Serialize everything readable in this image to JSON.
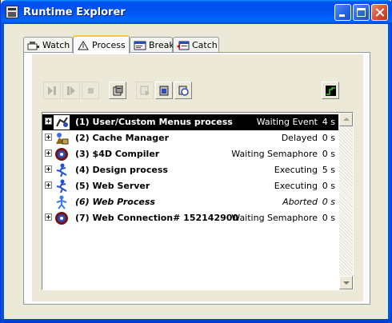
{
  "window": {
    "title": "Runtime Explorer"
  },
  "tabs": [
    {
      "label": "Watch",
      "icon": "watch-icon",
      "active": false
    },
    {
      "label": "Process",
      "icon": "process-icon",
      "active": true
    },
    {
      "label": "Break",
      "icon": "break-icon",
      "active": false
    },
    {
      "label": "Catch",
      "icon": "catch-icon",
      "active": false
    }
  ],
  "toolbar": {
    "buttons": [
      {
        "name": "abort-process-button",
        "icon": "abort-icon",
        "enabled": false
      },
      {
        "name": "pause-process-button",
        "icon": "pause-icon",
        "enabled": false
      },
      {
        "name": "stop-process-button",
        "icon": "stop-icon",
        "enabled": false
      },
      {
        "name": "process-info-button",
        "icon": "info-icon",
        "enabled": true
      },
      {
        "name": "debug-button",
        "icon": "debug-icon",
        "enabled": false
      },
      {
        "name": "trace-button",
        "icon": "trace-icon",
        "enabled": true
      },
      {
        "name": "show-window-button",
        "icon": "window-icon",
        "enabled": true
      },
      {
        "name": "activity-graph-button",
        "icon": "graph-icon",
        "enabled": true
      }
    ]
  },
  "processes": [
    {
      "name": "(1) User/Custom Menus process",
      "state": "Waiting Event",
      "time": "4 s",
      "selected": true,
      "italic": false,
      "icon": "menus-process-icon"
    },
    {
      "name": "(2) Cache Manager",
      "state": "Delayed",
      "time": "0 s",
      "selected": false,
      "italic": false,
      "icon": "cache-manager-icon"
    },
    {
      "name": "(3) $4D Compiler",
      "state": "Waiting Semaphore",
      "time": "0 s",
      "selected": false,
      "italic": false,
      "icon": "compiler-icon"
    },
    {
      "name": "(4) Design process",
      "state": "Executing",
      "time": "5 s",
      "selected": false,
      "italic": false,
      "icon": "design-process-icon"
    },
    {
      "name": "(5) Web Server",
      "state": "Executing",
      "time": "0 s",
      "selected": false,
      "italic": false,
      "icon": "web-server-icon"
    },
    {
      "name": "(6) Web Process",
      "state": "Aborted",
      "time": "0 s",
      "selected": false,
      "italic": true,
      "icon": "web-process-icon"
    },
    {
      "name": "(7) Web Connection# 152142900",
      "state": "Waiting Semaphore",
      "time": "0 s",
      "selected": false,
      "italic": false,
      "icon": "web-connection-icon"
    }
  ],
  "colors": {
    "titlebar": "#0054e3",
    "tab_highlight": "#ffc83c",
    "selection": "#000000",
    "window_bg": "#ece9d8"
  }
}
